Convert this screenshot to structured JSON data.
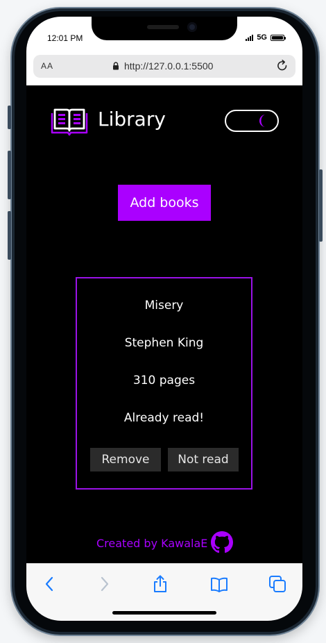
{
  "status": {
    "time": "12:01 PM",
    "network": "5G"
  },
  "browser": {
    "text_size_label": "AA",
    "url": "http://127.0.0.1:5500"
  },
  "header": {
    "title": "Library",
    "theme_toggle_state": "dark"
  },
  "actions": {
    "add_books_label": "Add books"
  },
  "books": [
    {
      "title": "Misery",
      "author": "Stephen King",
      "pages": "310 pages",
      "status": "Already read!",
      "remove_label": "Remove",
      "toggle_read_label": "Not read"
    }
  ],
  "footer": {
    "credit": "Created by KawalaE"
  },
  "colors": {
    "accent": "#aa00ff",
    "background": "#000000",
    "card_border": "#9a12e8",
    "ios_blue": "#1a7cff"
  },
  "icons": {
    "logo": "open-book-icon",
    "theme": "moon-icon",
    "footer": "github-icon",
    "toolbar": [
      "back-icon",
      "forward-icon",
      "share-icon",
      "bookmarks-icon",
      "tabs-icon"
    ]
  }
}
